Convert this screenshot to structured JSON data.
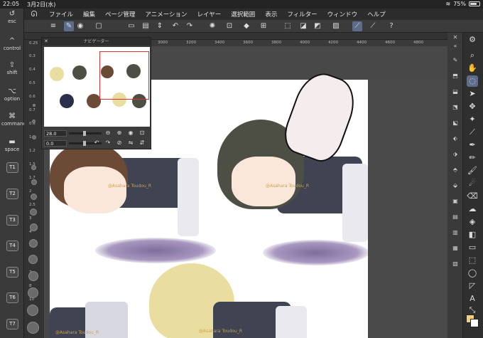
{
  "status": {
    "time": "22:05",
    "date": "3月2日(水)",
    "battery": "75%",
    "battery_level": 0.75
  },
  "menu": {
    "items": [
      "ファイル",
      "編集",
      "ページ管理",
      "アニメーション",
      "レイヤー",
      "選択範囲",
      "表示",
      "フィルター",
      "ウィンドウ",
      "ヘルプ"
    ]
  },
  "left_panel": {
    "keys": [
      "esc",
      "control",
      "shift",
      "option",
      "command",
      "space"
    ],
    "tabs": [
      "T1",
      "T2",
      "T3",
      "T4",
      "T5",
      "T6",
      "T7"
    ]
  },
  "size_labels": [
    "0.25",
    "0.3",
    "0.4",
    "0.5",
    "0.6",
    "0.7",
    "0.8",
    "1",
    "1.2",
    "1.5",
    "1.7",
    "2",
    "2.5",
    "3",
    "4",
    "5",
    "6",
    "7",
    "8",
    "10"
  ],
  "ruler": {
    "ticks": [
      "3000",
      "3200",
      "3400",
      "3600",
      "3800",
      "4000",
      "4200",
      "4400",
      "4600",
      "4800"
    ]
  },
  "navigator": {
    "title": "ナビゲーター",
    "zoom": "28.0",
    "rotation": "0.0"
  },
  "artwork": {
    "watermark": "@Asahara Toudou_R"
  }
}
